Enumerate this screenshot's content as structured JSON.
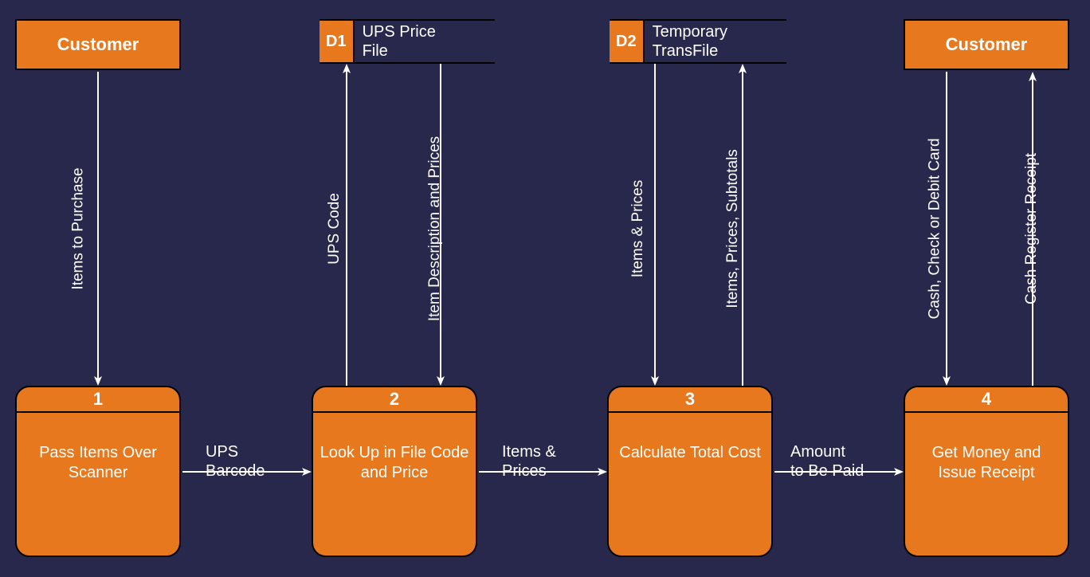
{
  "entities": {
    "customer_left": "Customer",
    "customer_right": "Customer"
  },
  "datastores": {
    "d1": {
      "id": "D1",
      "label": "UPS Price\nFile"
    },
    "d2": {
      "id": "D2",
      "label": "Temporary\nTransFile"
    }
  },
  "processes": {
    "p1": {
      "id": "1",
      "label": "Pass Items Over Scanner"
    },
    "p2": {
      "id": "2",
      "label": "Look Up in File Code and Price"
    },
    "p3": {
      "id": "3",
      "label": "Calculate Total Cost"
    },
    "p4": {
      "id": "4",
      "label": "Get Money and Issue Receipt"
    }
  },
  "flows": {
    "f_items_to_purchase": "Items to Purchase",
    "f_ups_code": "UPS Code",
    "f_item_desc_prices": "Item Description and Prices",
    "f_items_prices_v": "Items & Prices",
    "f_items_prices_subtotals": "Items, Prices, Subtotals",
    "f_cash_check_debit": "Cash, Check or Debit Card",
    "f_cash_register_receipt": "Cash Register Receipt",
    "f_ups_barcode": "UPS\nBarcode",
    "f_items_prices_h": "Items &\nPrices",
    "f_amount_to_be_paid": "Amount\nto Be Paid"
  }
}
